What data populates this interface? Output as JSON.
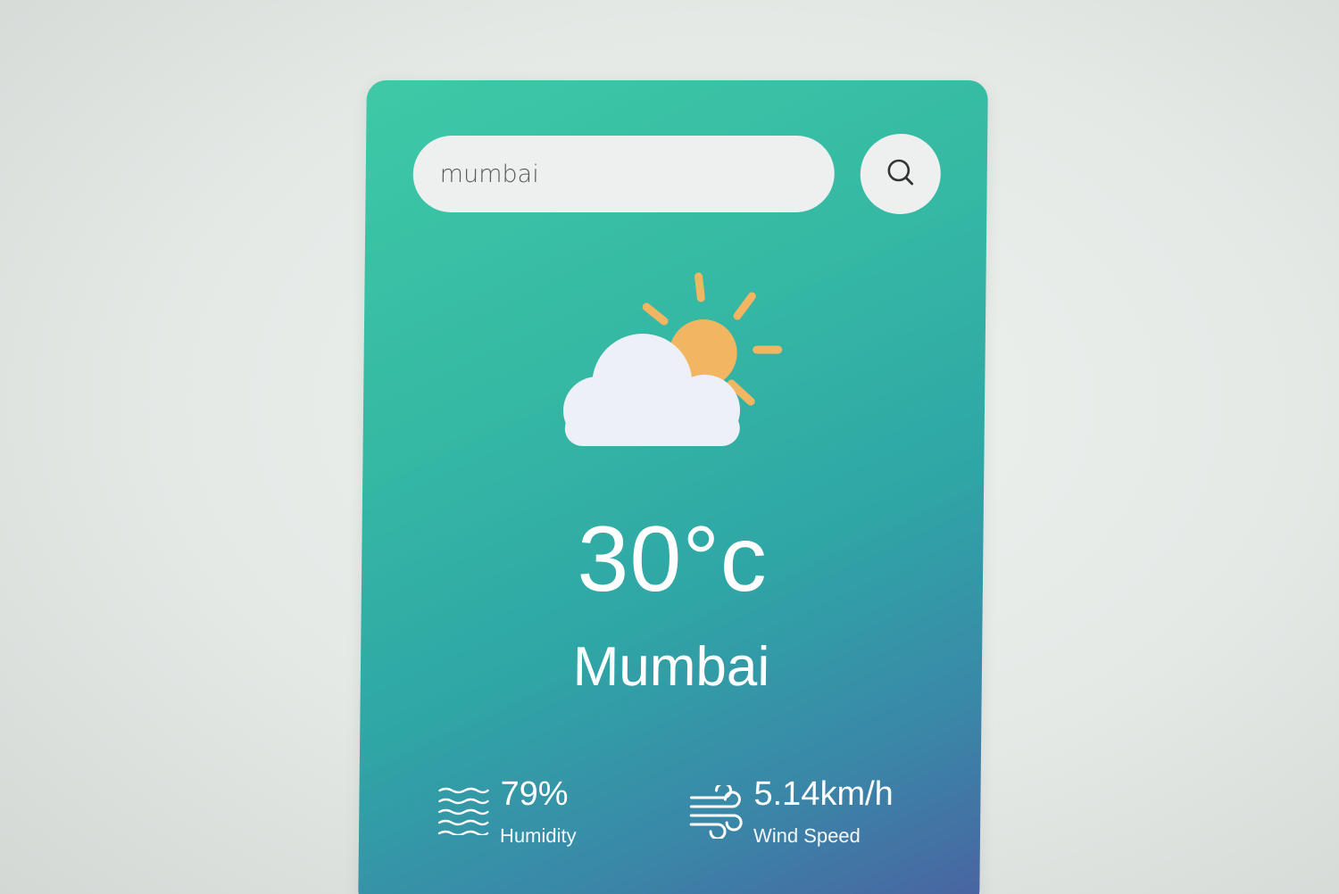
{
  "search": {
    "value": "mumbai",
    "placeholder": "",
    "button_icon": "search-icon"
  },
  "weather": {
    "icon": "partly-cloudy-icon",
    "temperature": "30°c",
    "city": "Mumbai"
  },
  "details": {
    "humidity": {
      "icon": "humidity-icon",
      "value": "79%",
      "label": "Humidity"
    },
    "wind": {
      "icon": "wind-icon",
      "value": "5.14km/h",
      "label": "Wind Speed"
    }
  },
  "colors": {
    "card_gradient_start": "#3ec9a6",
    "card_gradient_end": "#4a62a0",
    "sun": "#f2b562",
    "cloud": "#eef0f8",
    "input_bg": "#eef0f0"
  }
}
